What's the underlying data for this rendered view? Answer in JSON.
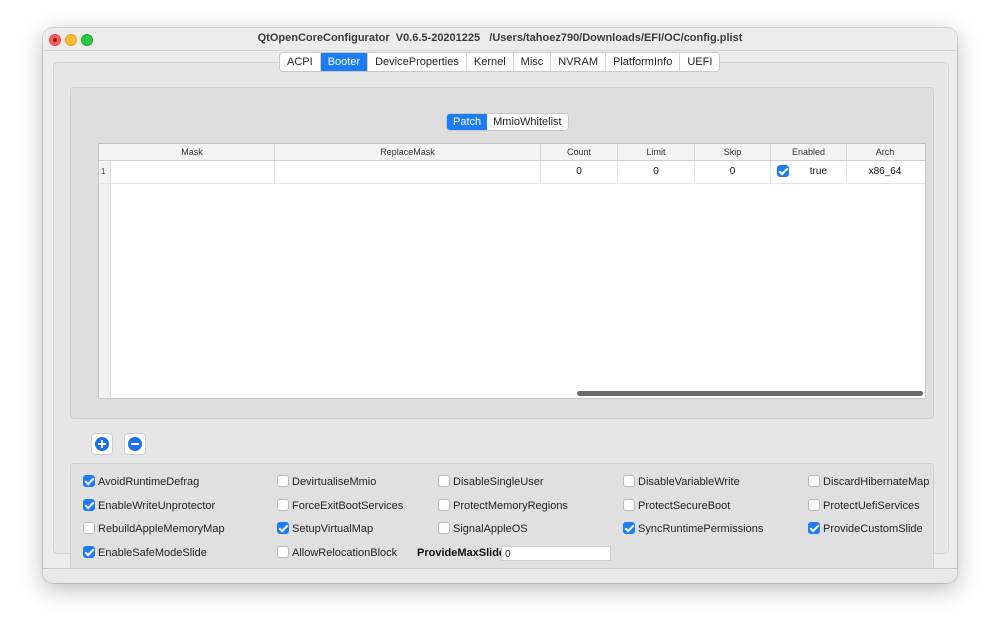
{
  "window": {
    "title": "QtOpenCoreConfigurator  V0.6.5-20201225   /Users/tahoez790/Downloads/EFI/OC/config.plist"
  },
  "tabs": [
    {
      "label": "ACPI",
      "active": false
    },
    {
      "label": "Booter",
      "active": true
    },
    {
      "label": "DeviceProperties",
      "active": false
    },
    {
      "label": "Kernel",
      "active": false
    },
    {
      "label": "Misc",
      "active": false
    },
    {
      "label": "NVRAM",
      "active": false
    },
    {
      "label": "PlatformInfo",
      "active": false
    },
    {
      "label": "UEFI",
      "active": false
    }
  ],
  "subtabs": [
    {
      "label": "Patch",
      "active": true
    },
    {
      "label": "MmioWhitelist",
      "active": false
    }
  ],
  "table": {
    "columns": [
      "Mask",
      "ReplaceMask",
      "Count",
      "Limit",
      "Skip",
      "Enabled",
      "Arch"
    ],
    "rows": [
      {
        "num": "1",
        "mask": "",
        "replacemask": "",
        "count": "0",
        "limit": "0",
        "skip": "0",
        "enabled_checked": true,
        "enabled": "true",
        "arch": "x86_64"
      }
    ]
  },
  "buttons": {
    "add_icon": "plus-circle-icon",
    "remove_icon": "minus-circle-icon"
  },
  "options": {
    "avoid_runtime_defrag": {
      "label": "AvoidRuntimeDefrag",
      "checked": true
    },
    "devirtualise_mmio": {
      "label": "DevirtualiseMmio",
      "checked": false
    },
    "disable_single_user": {
      "label": "DisableSingleUser",
      "checked": false
    },
    "disable_variable_write": {
      "label": "DisableVariableWrite",
      "checked": false
    },
    "discard_hibernate_map": {
      "label": "DiscardHibernateMap",
      "checked": false
    },
    "enable_write_unprotector": {
      "label": "EnableWriteUnprotector",
      "checked": true
    },
    "force_exit_boot_services": {
      "label": "ForceExitBootServices",
      "checked": false
    },
    "protect_memory_regions": {
      "label": "ProtectMemoryRegions",
      "checked": false
    },
    "protect_secure_boot": {
      "label": "ProtectSecureBoot",
      "checked": false
    },
    "protect_uefi_services": {
      "label": "ProtectUefiServices",
      "checked": false
    },
    "rebuild_apple_memory_map": {
      "label": "RebuildAppleMemoryMap",
      "checked": false
    },
    "setup_virtual_map": {
      "label": "SetupVirtualMap",
      "checked": true
    },
    "signal_apple_os": {
      "label": "SignalAppleOS",
      "checked": false
    },
    "sync_runtime_permissions": {
      "label": "SyncRuntimePermissions",
      "checked": true
    },
    "provide_custom_slide": {
      "label": "ProvideCustomSlide",
      "checked": true
    },
    "enable_safe_mode_slide": {
      "label": "EnableSafeModeSlide",
      "checked": true
    },
    "allow_relocation_block": {
      "label": "AllowRelocationBlock",
      "checked": false
    },
    "provide_max_slide": {
      "label": "ProvideMaxSlide",
      "value": "0"
    }
  },
  "colors": {
    "accent": "#1b7cf6"
  }
}
